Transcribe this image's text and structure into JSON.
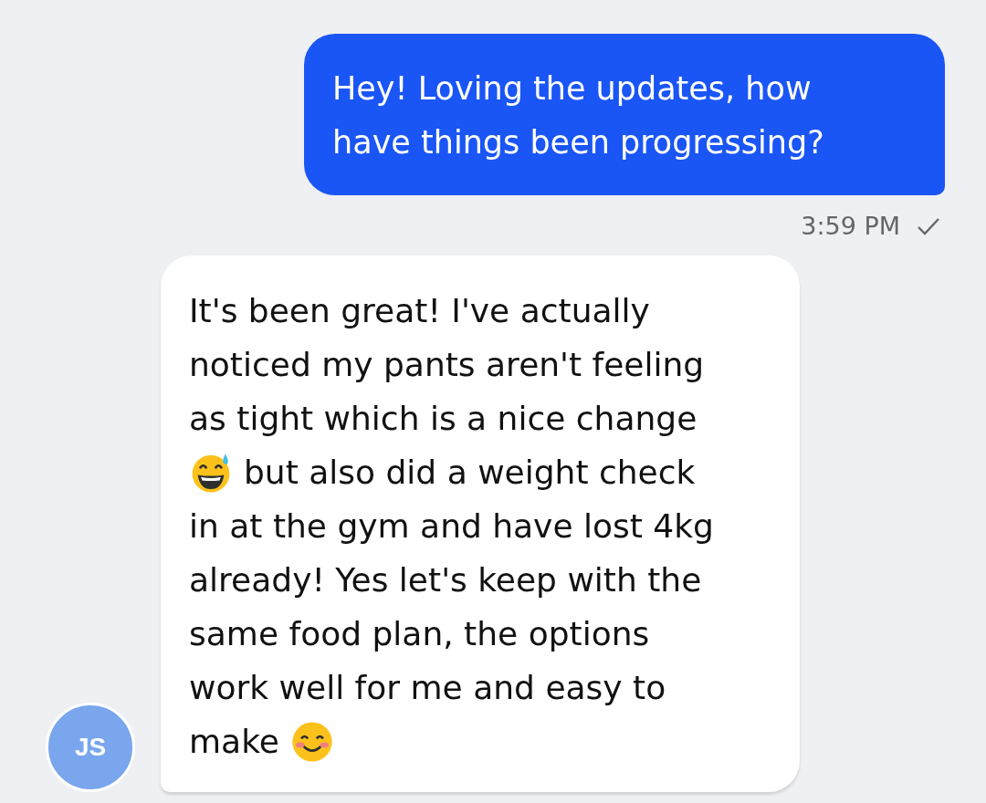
{
  "messages": [
    {
      "kind": "outgoing",
      "lines": [
        [
          {
            "kind": "text",
            "text": "Hey! Loving the updates, how"
          }
        ],
        [
          {
            "kind": "text",
            "text": "have things been progressing?"
          }
        ]
      ],
      "time": "3:59 PM"
    },
    {
      "kind": "incoming",
      "avatar": "JS",
      "lines": [
        [
          {
            "kind": "text",
            "text": "It's been great! I've actually"
          }
        ],
        [
          {
            "kind": "text",
            "text": "noticed my pants aren't feeling"
          }
        ],
        [
          {
            "kind": "text",
            "text": "as tight which is a nice change"
          }
        ],
        [
          {
            "kind": "emoji_sweat"
          },
          {
            "kind": "text",
            "text": "but also did a weight check"
          }
        ],
        [
          {
            "kind": "text",
            "text": "in at the gym and have lost 4kg"
          }
        ],
        [
          {
            "kind": "text",
            "text": "already! Yes let's keep with the"
          }
        ],
        [
          {
            "kind": "text",
            "text": "same food plan, the options"
          }
        ],
        [
          {
            "kind": "text",
            "text": "work well for me and easy to"
          }
        ],
        [
          {
            "kind": "text",
            "text": "make"
          },
          {
            "kind": "emoji_smile"
          }
        ]
      ]
    }
  ]
}
